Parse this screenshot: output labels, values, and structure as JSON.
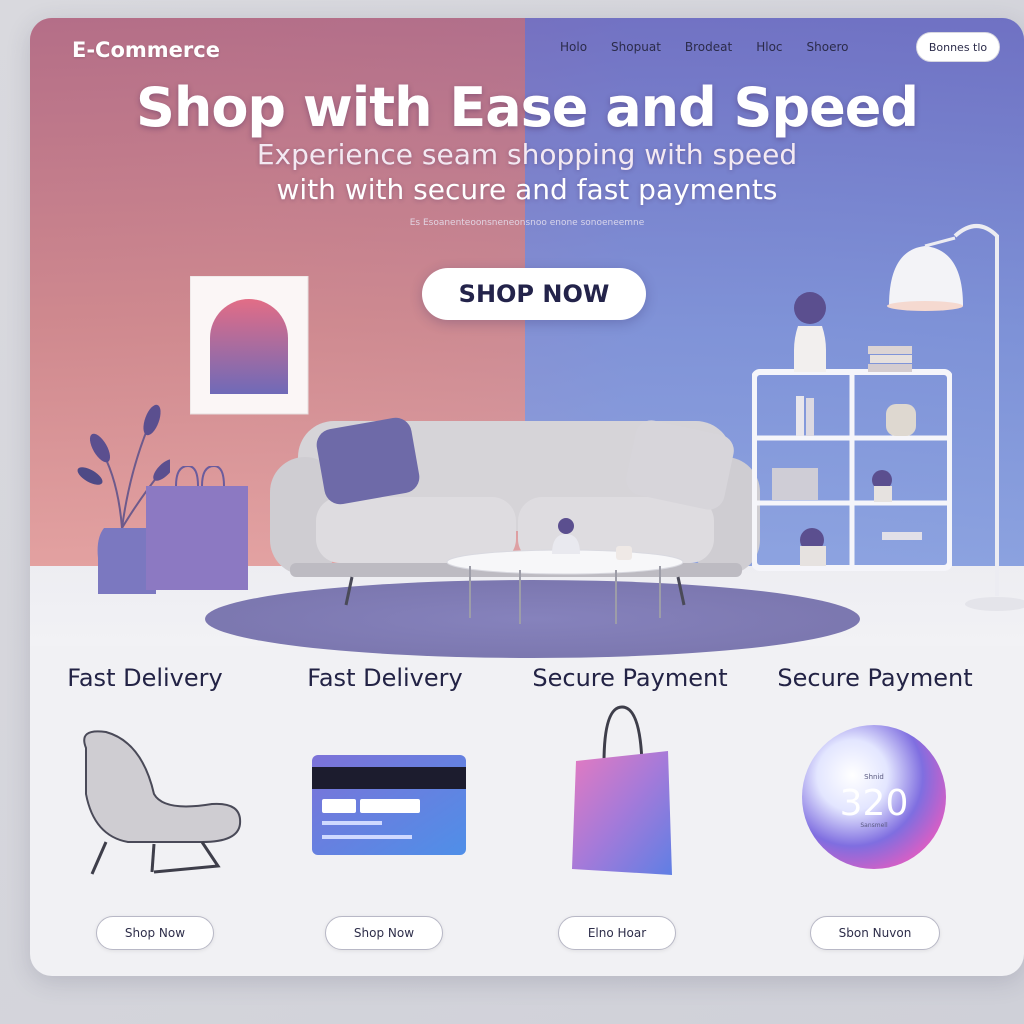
{
  "brand": "E-Commerce",
  "nav": {
    "items": [
      "Holo",
      "Shopuat",
      "Brodeat",
      "Hloc",
      "Shoero"
    ],
    "cta_label": "Bonnes tlo"
  },
  "hero": {
    "headline": "Shop with Ease and Speed",
    "subheadline_1": "Experience seam shopping with speed",
    "subheadline_2": "with with secure and fast payments",
    "fineprint": "Es Esoanenteoonsneneonsnoo enone sonoeneemne",
    "cta_label": "SHOP NOW"
  },
  "features": [
    {
      "title": "Fast Delivery",
      "button_label": "Shop Now",
      "icon": "lounge-chair-icon"
    },
    {
      "title": "Fast Delivery",
      "button_label": "Shop Now",
      "icon": "credit-card-icon"
    },
    {
      "title": "Secure Payment",
      "button_label": "Elno Hoar",
      "icon": "shopping-bag-icon"
    },
    {
      "title": "Secure Payment",
      "button_label": "Sbon Nuvon",
      "icon": "badge-orb-icon"
    }
  ],
  "orb": {
    "value": "320",
    "caption": "Shnid",
    "subcaption": "Sansmell"
  },
  "colors": {
    "pink_wall": "#c98096",
    "blue_wall": "#7f93d8",
    "rug": "#6f6aa8",
    "text_dark": "#232345",
    "white": "#ffffff"
  }
}
